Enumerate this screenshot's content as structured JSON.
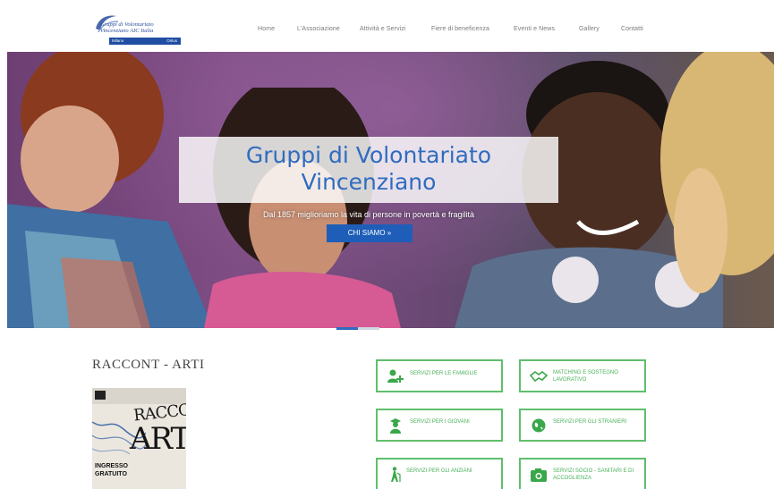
{
  "header": {
    "logo": {
      "line1": "Gruppi di Volontariato",
      "line2": "Vincenziano AIC Italia",
      "bar_left": "Milano",
      "bar_right": "Onlus"
    },
    "nav": [
      {
        "label": "Home"
      },
      {
        "label": "L'Associazione"
      },
      {
        "label": "Attività e Servizi"
      },
      {
        "label": "Fiere di beneficenza"
      },
      {
        "label": "Eventi e News"
      },
      {
        "label": "Gallery"
      },
      {
        "label": "Contatti"
      }
    ]
  },
  "hero": {
    "title_line1": "Gruppi di Volontariato",
    "title_line2": "Vincenziano",
    "subtitle": "Dal 1857 miglioriamo la vita di persone in povertà e fragilità",
    "button_label": "CHI SIAMO »"
  },
  "section": {
    "title": "RACCONT - ARTI",
    "poster": {
      "word1": "RACCONT",
      "word2": "ARTI",
      "ingresso1": "INGRESSO",
      "ingresso2": "GRATUITO"
    }
  },
  "services": [
    {
      "label": "SERVIZI PER LE FAMIGLIE",
      "icon": "family-add-icon"
    },
    {
      "label": "MATCHING E SOSTEGNO LAVORATIVO",
      "icon": "handshake-icon"
    },
    {
      "label": "SERVIZI PER I GIOVANI",
      "icon": "graduate-icon"
    },
    {
      "label": "SERVIZI PER GLI STRANIERI",
      "icon": "globe-icon"
    },
    {
      "label": "SERVIZI PER GLI ANZIANI",
      "icon": "elderly-walking-icon"
    },
    {
      "label": "SERVIZI SOCIO - SANITARI E DI ACCOGLIENZA",
      "icon": "camera-icon"
    }
  ],
  "colors": {
    "primary_blue": "#2f6cc0",
    "button_blue": "#1e5eb8",
    "service_green": "#5fbf6c"
  }
}
